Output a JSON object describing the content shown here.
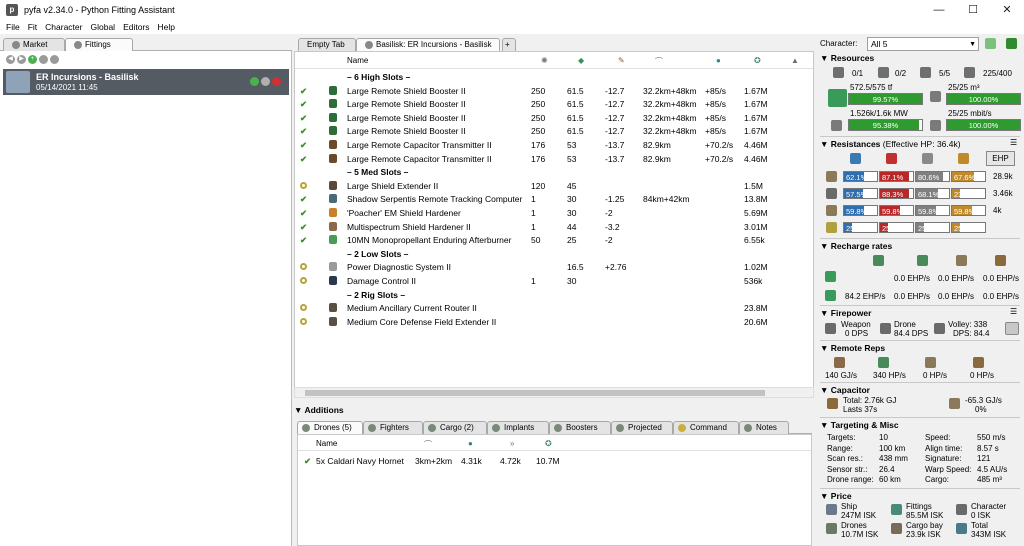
{
  "window": {
    "title": "pyfa v2.34.0 - Python Fitting Assistant",
    "minimize": "—",
    "maximize": "☐",
    "close": "✕"
  },
  "menu": [
    "File",
    "Fit",
    "Character",
    "Global",
    "Editors",
    "Help"
  ],
  "left_tabs": [
    "Market",
    "Fittings"
  ],
  "fit": {
    "name": "ER Incursions - Basilisk",
    "date": "05/14/2021 11:45"
  },
  "center_tabs": [
    "Empty Tab",
    "Basilisk: ER Incursions - Basilisk"
  ],
  "columns": [
    "Name"
  ],
  "rows": [
    {
      "kind": "section",
      "name": "– 6 High Slots –"
    },
    {
      "kind": "module",
      "state": "active",
      "icon": "#2c6d3a",
      "name": "Large Remote Shield Booster II",
      "c1": "250",
      "c2": "61.5",
      "c3": "-12.7",
      "c4": "32.2km+48km",
      "c5": "+85/s",
      "c6": "1.67M"
    },
    {
      "kind": "module",
      "state": "active",
      "icon": "#2c6d3a",
      "name": "Large Remote Shield Booster II",
      "c1": "250",
      "c2": "61.5",
      "c3": "-12.7",
      "c4": "32.2km+48km",
      "c5": "+85/s",
      "c6": "1.67M"
    },
    {
      "kind": "module",
      "state": "active",
      "icon": "#2c6d3a",
      "name": "Large Remote Shield Booster II",
      "c1": "250",
      "c2": "61.5",
      "c3": "-12.7",
      "c4": "32.2km+48km",
      "c5": "+85/s",
      "c6": "1.67M"
    },
    {
      "kind": "module",
      "state": "active",
      "icon": "#2c6d3a",
      "name": "Large Remote Shield Booster II",
      "c1": "250",
      "c2": "61.5",
      "c3": "-12.7",
      "c4": "32.2km+48km",
      "c5": "+85/s",
      "c6": "1.67M"
    },
    {
      "kind": "module",
      "state": "active",
      "icon": "#6b4a2a",
      "name": "Large Remote Capacitor Transmitter II",
      "c1": "176",
      "c2": "53",
      "c3": "-13.7",
      "c4": "82.9km",
      "c5": "+70.2/s",
      "c6": "4.46M"
    },
    {
      "kind": "module",
      "state": "active",
      "icon": "#6b4a2a",
      "name": "Large Remote Capacitor Transmitter II",
      "c1": "176",
      "c2": "53",
      "c3": "-13.7",
      "c4": "82.9km",
      "c5": "+70.2/s",
      "c6": "4.46M"
    },
    {
      "kind": "section",
      "name": "– 5 Med Slots –"
    },
    {
      "kind": "module",
      "state": "idle",
      "icon": "#5a4a35",
      "name": "Large Shield Extender II",
      "c1": "120",
      "c2": "45",
      "c3": "",
      "c4": "",
      "c5": "",
      "c6": "1.5M"
    },
    {
      "kind": "module",
      "state": "active",
      "icon": "#4a6a7a",
      "name": "Shadow Serpentis Remote Tracking Computer",
      "c1": "1",
      "c2": "30",
      "c3": "-1.25",
      "c4": "84km+42km",
      "c5": "",
      "c6": "13.8M"
    },
    {
      "kind": "module",
      "state": "active",
      "icon": "#c8802a",
      "name": "'Poacher' EM Shield Hardener",
      "c1": "1",
      "c2": "30",
      "c3": "-2",
      "c4": "",
      "c5": "",
      "c6": "5.69M"
    },
    {
      "kind": "module",
      "state": "active",
      "icon": "#8a6a4a",
      "name": "Multispectrum Shield Hardener II",
      "c1": "1",
      "c2": "44",
      "c3": "-3.2",
      "c4": "",
      "c5": "",
      "c6": "3.01M"
    },
    {
      "kind": "module",
      "state": "active",
      "icon": "#4a9a5a",
      "name": "10MN Monopropellant Enduring Afterburner",
      "c1": "50",
      "c2": "25",
      "c3": "-2",
      "c4": "",
      "c5": "",
      "c6": "6.55k"
    },
    {
      "kind": "section",
      "name": "– 2 Low Slots –"
    },
    {
      "kind": "module",
      "state": "idle",
      "icon": "#9a9a9a",
      "name": "Power Diagnostic System II",
      "c1": "",
      "c2": "16.5",
      "c3": "+2.76",
      "c4": "",
      "c5": "",
      "c6": "1.02M"
    },
    {
      "kind": "module",
      "state": "idle",
      "icon": "#2a3a4a",
      "name": "Damage Control II",
      "c1": "1",
      "c2": "30",
      "c3": "",
      "c4": "",
      "c5": "",
      "c6": "536k"
    },
    {
      "kind": "section",
      "name": "– 2 Rig Slots –"
    },
    {
      "kind": "module",
      "state": "idle",
      "icon": "#5a5040",
      "name": "Medium Ancillary Current Router II",
      "c1": "",
      "c2": "",
      "c3": "",
      "c4": "",
      "c5": "",
      "c6": "23.8M"
    },
    {
      "kind": "module",
      "state": "idle",
      "icon": "#5a5040",
      "name": "Medium Core Defense Field Extender II",
      "c1": "",
      "c2": "",
      "c3": "",
      "c4": "",
      "c5": "",
      "c6": "20.6M"
    }
  ],
  "additions": {
    "title": "Additions",
    "tabs": [
      "Drones (5)",
      "Fighters",
      "Cargo (2)",
      "Implants",
      "Boosters",
      "Projected",
      "Command",
      "Notes"
    ],
    "drone_header": "Name",
    "drones": [
      {
        "name": "5x Caldari Navy Hornet",
        "range": "3km+2km",
        "c2": "4.31k",
        "c3": "4.72k",
        "price": "10.7M"
      }
    ]
  },
  "character": {
    "label": "Character:",
    "value": "All 5"
  },
  "resources": {
    "title": "Resources",
    "turrets": "0/1",
    "launchers": "0/2",
    "drones_active": "5/5",
    "drone_bay": "225/400",
    "cpu_text": "572.5/575 tf",
    "cpu_pct": "99.57%",
    "cpu_fill": 0.9957,
    "drone_bw_text": "25/25 m³",
    "drone_bw_pct": "100.00%",
    "drone_bw_fill": 1.0,
    "pg_text": "1.526k/1.6k MW",
    "pg_pct": "95.38%",
    "pg_fill": 0.9538,
    "bw_text": "25/25 mbit/s",
    "bw_pct": "100.00%",
    "bw_fill": 1.0
  },
  "resistances": {
    "title": "Resistances",
    "ehp_title": "(Effective HP: 36.4k)",
    "ehp_btn": "EHP",
    "rows": [
      {
        "vals": [
          "62.1%",
          "87.1%",
          "80.6%",
          "67.6%"
        ],
        "fills": [
          0.621,
          0.871,
          0.806,
          0.676
        ],
        "hp": "28.9k"
      },
      {
        "vals": [
          "57.5%",
          "88.3%",
          "68.1%",
          "23.5%"
        ],
        "fills": [
          0.575,
          0.883,
          0.681,
          0.235
        ],
        "hp": "3.46k"
      },
      {
        "vals": [
          "59.8%",
          "59.8%",
          "59.8%",
          "59.8%"
        ],
        "fills": [
          0.598,
          0.598,
          0.598,
          0.598
        ],
        "hp": "4k"
      },
      {
        "vals": [
          "25.0%",
          "25.0%",
          "25.0%",
          "25.0%"
        ],
        "fills": [
          0.25,
          0.25,
          0.25,
          0.25
        ],
        "hp": ""
      }
    ]
  },
  "recharge": {
    "title": "Recharge rates",
    "r1": [
      "0.0 EHP/s",
      "0.0 EHP/s",
      "0.0 EHP/s"
    ],
    "r2": [
      "84.2 EHP/s",
      "0.0 EHP/s",
      "0.0 EHP/s",
      "0.0 EHP/s"
    ]
  },
  "firepower": {
    "title": "Firepower",
    "weapon": "Weapon",
    "weapon_dps": "0 DPS",
    "drone": "Drone",
    "drone_dps": "84.4 DPS",
    "volley": "Volley: 338",
    "dps": "DPS: 84.4"
  },
  "remote_reps": {
    "title": "Remote Reps",
    "vals": [
      "140 GJ/s",
      "340 HP/s",
      "0 HP/s",
      "0 HP/s"
    ]
  },
  "capacitor": {
    "title": "Capacitor",
    "total": "Total: 2.76k GJ",
    "lasts": "Lasts 37s",
    "delta": "-65.3 GJ/s",
    "pct": "0%"
  },
  "targeting": {
    "title": "Targeting & Misc",
    "left": [
      [
        "Targets:",
        "10"
      ],
      [
        "Range:",
        "100 km"
      ],
      [
        "Scan res.:",
        "438 mm"
      ],
      [
        "Sensor str.:",
        "26.4"
      ],
      [
        "Drone range:",
        "60 km"
      ]
    ],
    "right": [
      [
        "Speed:",
        "550 m/s"
      ],
      [
        "Align time:",
        "8.57 s"
      ],
      [
        "Signature:",
        "121"
      ],
      [
        "Warp Speed:",
        "4.5 AU/s"
      ],
      [
        "Cargo:",
        "485 m³"
      ]
    ]
  },
  "price": {
    "title": "Price",
    "ship_l": "Ship",
    "ship_v": "247M ISK",
    "fittings_l": "Fittings",
    "fittings_v": "85.5M ISK",
    "char_l": "Character",
    "char_v": "0 ISK",
    "drones_l": "Drones",
    "drones_v": "10.7M ISK",
    "cargo_l": "Cargo bay",
    "cargo_v": "23.9k ISK",
    "total_l": "Total",
    "total_v": "343M ISK"
  }
}
